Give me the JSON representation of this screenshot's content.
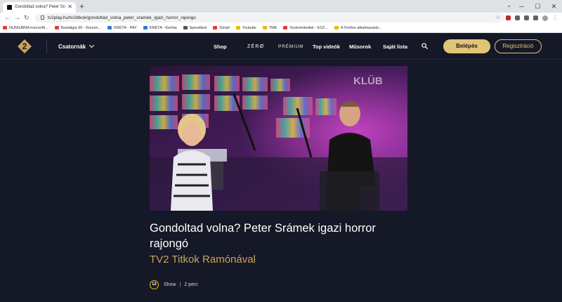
{
  "browser": {
    "tab_title": "Gondoltad volna? Peter Srámek",
    "url_domain": "tv2play.hu",
    "url_path": "/tv2titkok/gondoltad_volna_peter_sramek_igazi_horror_rajongo",
    "bookmarks": [
      {
        "label": "HUNGÁRIA koncertfi...",
        "color": "#e53935"
      },
      {
        "label": "Nostalgia 90 - Runnin...",
        "color": "#e53935"
      },
      {
        "label": "KRÉTA - PAY",
        "color": "#2b7bd6"
      },
      {
        "label": "KRÉTA - Kerëta",
        "color": "#2b7bd6"
      },
      {
        "label": "Speedtest",
        "color": "#555555"
      },
      {
        "label": "Gmail",
        "color": "#e53935"
      },
      {
        "label": "Youtube",
        "color": "#f2b600"
      },
      {
        "label": "TME",
        "color": "#f2b600"
      },
      {
        "label": "Szekrénbeliek - ESZ...",
        "color": "#e53935"
      },
      {
        "label": "A Firefox alkalmazásb...",
        "color": "#f2b600"
      }
    ]
  },
  "header": {
    "channels_label": "Csatornák",
    "nav": {
      "shop": "Shop",
      "zero": "ZÉRØ",
      "premium": "PRÉMIUM",
      "top_videos": "Top videók",
      "shows": "Műsorok",
      "my_list": "Saját lista"
    },
    "login_label": "Belépés",
    "register_label": "Regisztráció"
  },
  "video": {
    "watermark": "KLÜB",
    "title": "Gondoltad volna? Peter Srámek igazi horror rajongó",
    "show_name": "TV2 Titkok Ramónával",
    "age_rating": "12",
    "category": "Show",
    "separator": "|",
    "duration": "2 perc"
  },
  "colors": {
    "accent_gold": "#e2c477",
    "show_name": "#c9a45d",
    "background": "#151826"
  }
}
